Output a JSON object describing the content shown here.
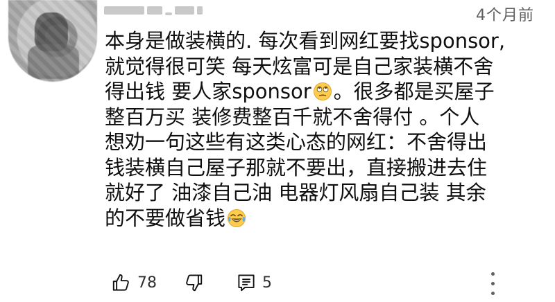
{
  "comment": {
    "timestamp": "4个月前",
    "lines": [
      "本身是做装横的. 每次看到网红要找sponsor,",
      "就觉得很可笑 每天炫富可是自己家装横不舍",
      "得出钱 要人家sponsor",
      "。很多都是买屋子",
      "整百万买 装修费整百千就不舍得付 。个人",
      "想劝一句这些有这类心态的网红：不舍得出",
      "钱装横自己屋子那就不要出，直接搬进去住",
      "就好了 油漆自己油 电器灯风扇自己装 其余",
      "的不要做省钱"
    ],
    "emojis": [
      "eye-roll-emoji",
      "laughing-tears-emoji"
    ]
  },
  "actions": {
    "like_count": "78",
    "reply_count": "5"
  },
  "icons": {
    "like": "thumbs-up-icon",
    "dislike": "thumbs-down-icon",
    "reply": "reply-icon",
    "more": "more-vertical-icon"
  },
  "colors": {
    "text": "#0f0f0f",
    "muted": "#606060",
    "background": "#ffffff"
  }
}
